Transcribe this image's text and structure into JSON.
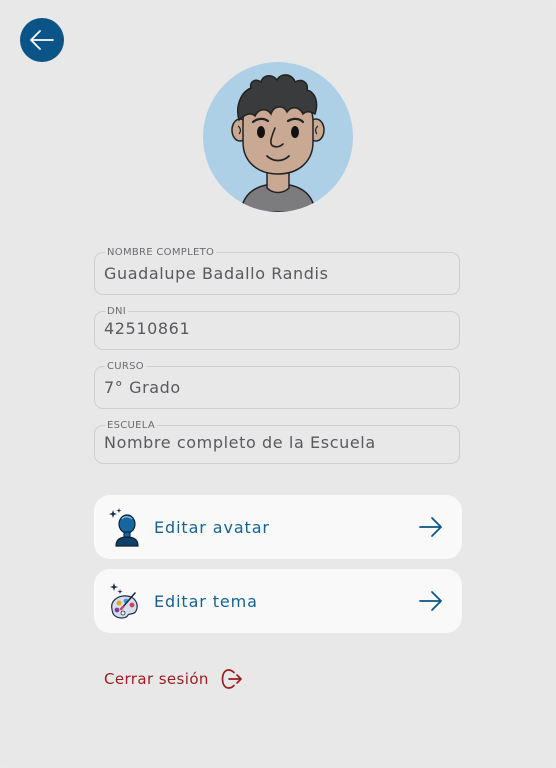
{
  "profile": {
    "fields": [
      {
        "label": "NOMBRE COMPLETO",
        "value": "Guadalupe Badallo Randis"
      },
      {
        "label": "DNI",
        "value": "42510861"
      },
      {
        "label": "CURSO",
        "value": "7° Grado"
      },
      {
        "label": "ESCUELA",
        "value": "Nombre completo de la Escuela"
      }
    ]
  },
  "actions": {
    "edit_avatar": {
      "label": "Editar avatar",
      "icon": "avatar-bust-icon"
    },
    "edit_theme": {
      "label": "Editar tema",
      "icon": "palette-icon"
    }
  },
  "logout": {
    "label": "Cerrar sesión",
    "icon": "logout-icon"
  },
  "colors": {
    "primary": "#0b5487",
    "action_text": "#136395",
    "logout": "#9d1c1c",
    "avatar_bg": "#add0e6"
  }
}
